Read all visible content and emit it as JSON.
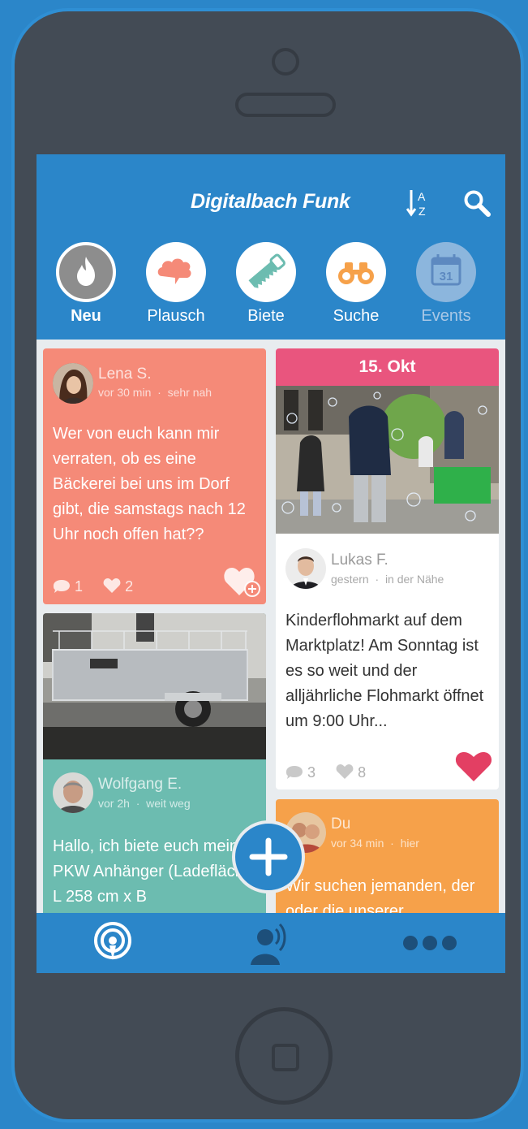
{
  "header": {
    "title": "Digitalbach Funk"
  },
  "categories": [
    {
      "label": "Neu"
    },
    {
      "label": "Plausch"
    },
    {
      "label": "Biete"
    },
    {
      "label": "Suche"
    },
    {
      "label": "Events",
      "day": "31"
    }
  ],
  "posts": {
    "lena": {
      "author": "Lena S.",
      "time": "vor 30 min",
      "distance": "sehr nah",
      "text": "Wer von euch kann mir verraten, ob es eine Bäckerei bei uns im Dorf gibt, die samstags nach 12 Uhr noch offen hat??",
      "comments": "1",
      "likes": "2"
    },
    "lukas": {
      "date": "15. Okt",
      "author": "Lukas F.",
      "time": "gestern",
      "distance": "in der Nähe",
      "text": "Kinderflohmarkt auf dem Marktplatz! Am Sonntag ist es so weit und der alljährliche Flohmarkt öffnet um 9:00 Uhr...",
      "comments": "3",
      "likes": "8"
    },
    "wolfgang": {
      "author": "Wolfgang E.",
      "time": "vor 2h",
      "distance": "weit weg",
      "text": "Hallo, ich biete euch meinen PKW Anhänger (Ladefläche: L 258 cm x B"
    },
    "du": {
      "author": "Du",
      "time": "vor 34 min",
      "distance": "hier",
      "text": "Wir suchen jemanden, der oder die unserer"
    }
  },
  "separator": "·",
  "colors": {
    "primary": "#2b86c9",
    "plausch_card": "#f58a78",
    "biete_card": "#6cbcb0",
    "suche_card": "#f6a14a",
    "event_banner": "#e9557e",
    "liked_heart": "#e33f63"
  }
}
